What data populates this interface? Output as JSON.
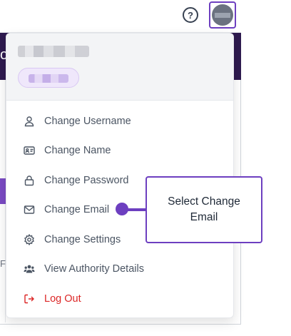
{
  "header": {
    "help_icon_glyph": "?",
    "avatar_icon": "user-avatar"
  },
  "background": {
    "band_char": "o",
    "left_char": "F"
  },
  "profile": {
    "name": "",
    "role": ""
  },
  "menu": {
    "items": [
      {
        "label": "Change Username",
        "icon": "user-icon"
      },
      {
        "label": "Change Name",
        "icon": "id-card-icon"
      },
      {
        "label": "Change Password",
        "icon": "lock-icon"
      },
      {
        "label": "Change Email",
        "icon": "mail-icon"
      },
      {
        "label": "Change Settings",
        "icon": "gear-icon"
      },
      {
        "label": "View Authority Details",
        "icon": "users-icon"
      },
      {
        "label": "Log Out",
        "icon": "logout-icon"
      }
    ]
  },
  "callout": {
    "text": "Select Change Email"
  },
  "colors": {
    "accent": "#6d3fc0",
    "logout": "#dc2626",
    "band": "#2e1a4f"
  }
}
